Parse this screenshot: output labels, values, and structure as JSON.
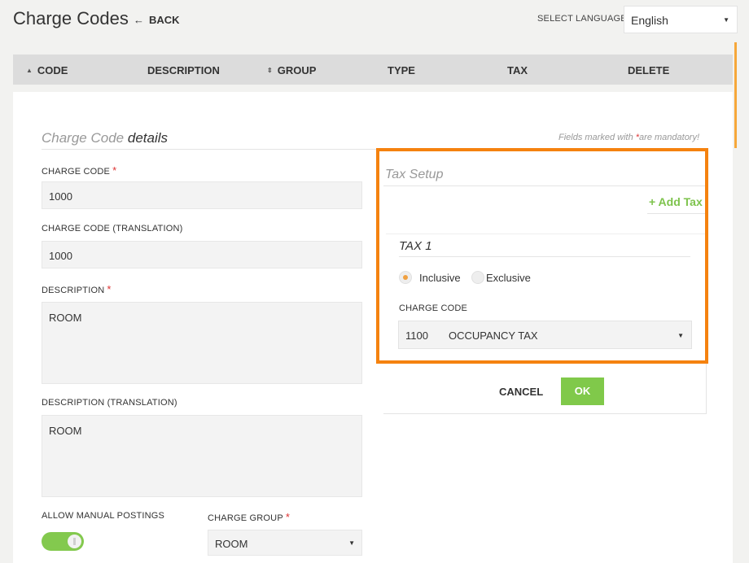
{
  "header": {
    "title": "Charge Codes",
    "back_label": "BACK",
    "language_label": "SELECT LANGUAGE",
    "language_value": "English"
  },
  "table": {
    "columns": [
      "CODE",
      "DESCRIPTION",
      "GROUP",
      "TYPE",
      "TAX",
      "DELETE"
    ]
  },
  "details": {
    "title_light": "Charge Code",
    "title_bold": "details",
    "mandatory_note": "Fields marked with ",
    "mandatory_star": "*",
    "mandatory_suffix": "are mandatory!",
    "charge_code_label": "CHARGE CODE",
    "charge_code_value": "1000",
    "charge_code_translation_label": "CHARGE CODE (TRANSLATION)",
    "charge_code_translation_value": "1000",
    "description_label": "DESCRIPTION",
    "description_value": "ROOM",
    "description_translation_label": "DESCRIPTION (TRANSLATION)",
    "description_translation_value": "ROOM",
    "allow_manual_label": "ALLOW MANUAL POSTINGS",
    "allow_manual_on": true,
    "charge_group_label": "CHARGE GROUP",
    "charge_group_value": "ROOM",
    "required_star": "*"
  },
  "tax_setup": {
    "title": "Tax Setup",
    "add_tax_label": "Add Tax",
    "tax_title": "TAX 1",
    "inclusive_label": "Inclusive",
    "exclusive_label": "Exclusive",
    "selected": "Inclusive",
    "charge_code_label": "CHARGE CODE",
    "charge_code_number": "1100",
    "charge_code_name": "OCCUPANCY TAX",
    "cancel_label": "CANCEL",
    "ok_label": "OK"
  },
  "colors": {
    "accent_green": "#80c94a",
    "highlight_orange": "#f5820f",
    "required_red": "#d33333"
  }
}
